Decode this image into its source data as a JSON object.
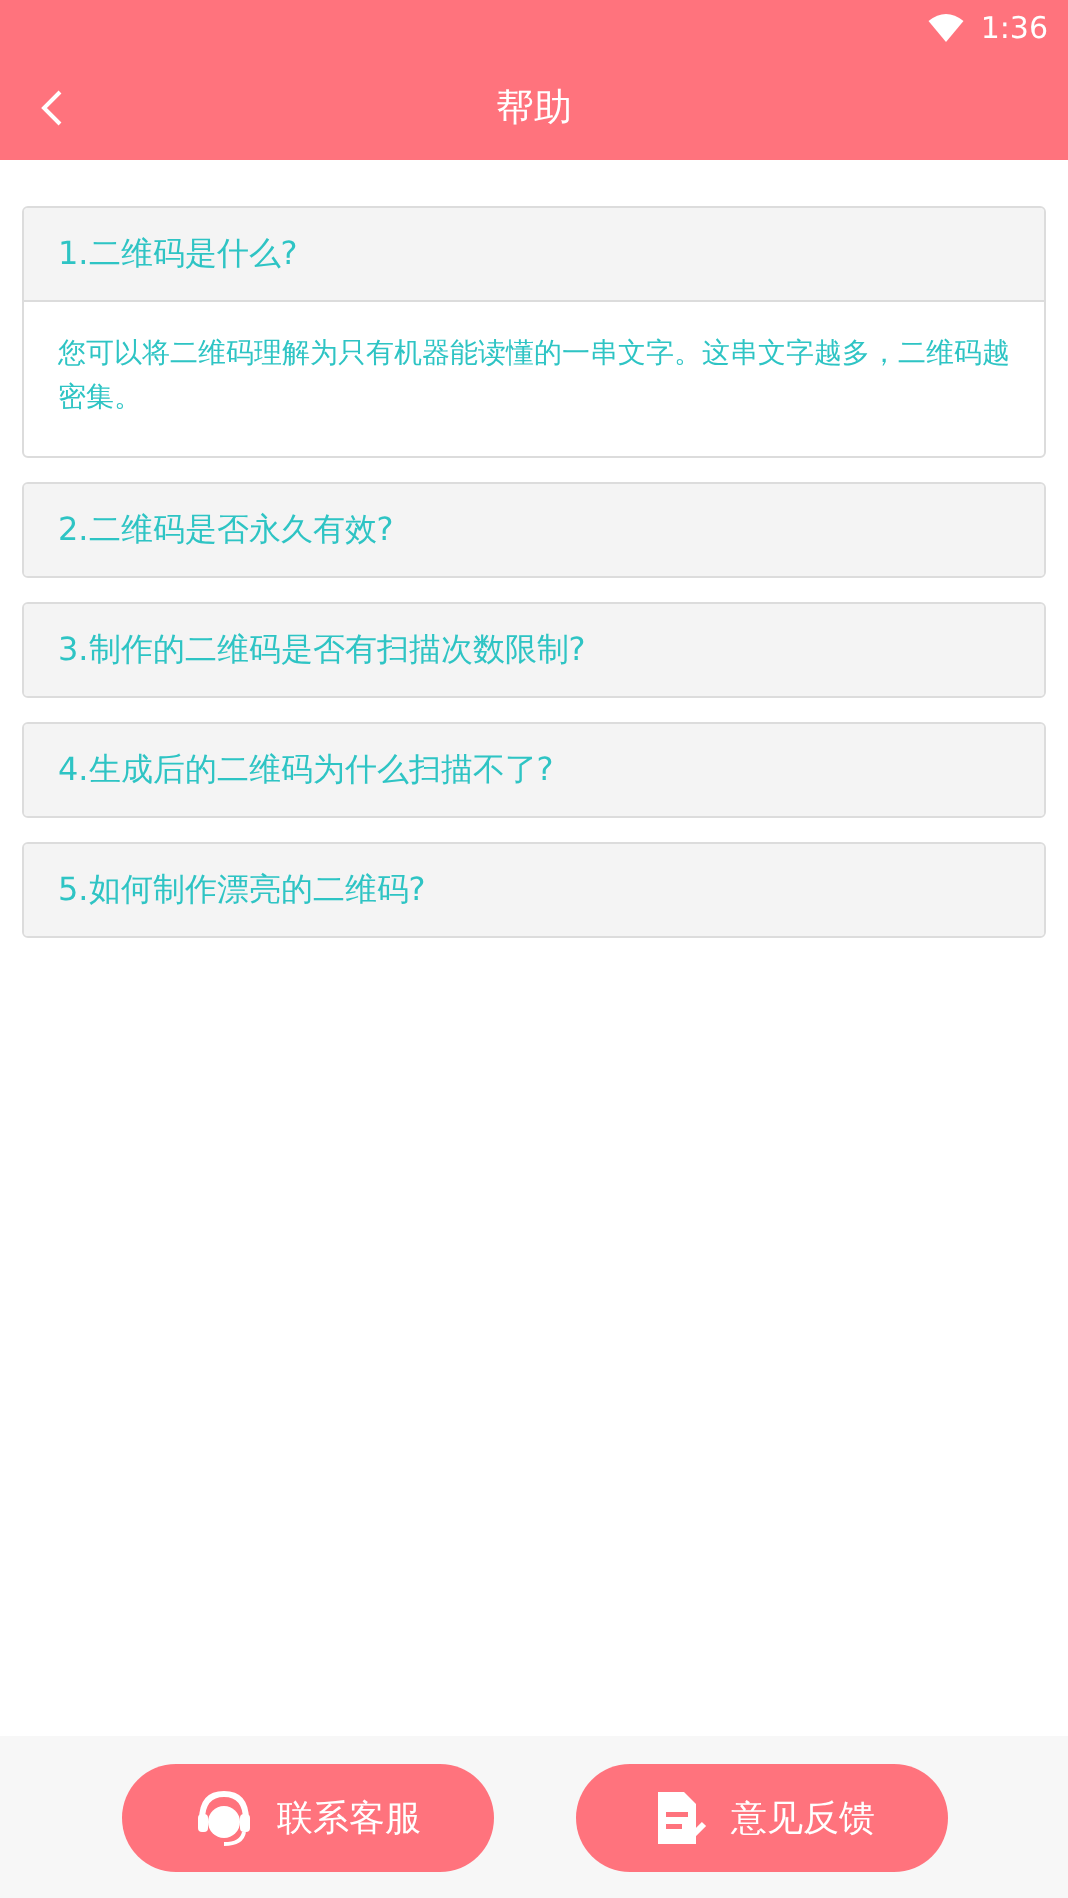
{
  "status_bar": {
    "time": "1:36"
  },
  "header": {
    "title": "帮助"
  },
  "faq": [
    {
      "question": "1.二维码是什么?",
      "expanded": true,
      "answer": "您可以将二维码理解为只有机器能读懂的一串文字。这串文字越多，二维码越密集。"
    },
    {
      "question": "2.二维码是否永久有效?",
      "expanded": false
    },
    {
      "question": "3.制作的二维码是否有扫描次数限制?",
      "expanded": false
    },
    {
      "question": "4.生成后的二维码为什么扫描不了?",
      "expanded": false
    },
    {
      "question": "5.如何制作漂亮的二维码?",
      "expanded": false
    }
  ],
  "buttons": [
    {
      "kind": "service",
      "label": "联系客服"
    },
    {
      "kind": "feedback",
      "label": "意见反馈"
    }
  ]
}
